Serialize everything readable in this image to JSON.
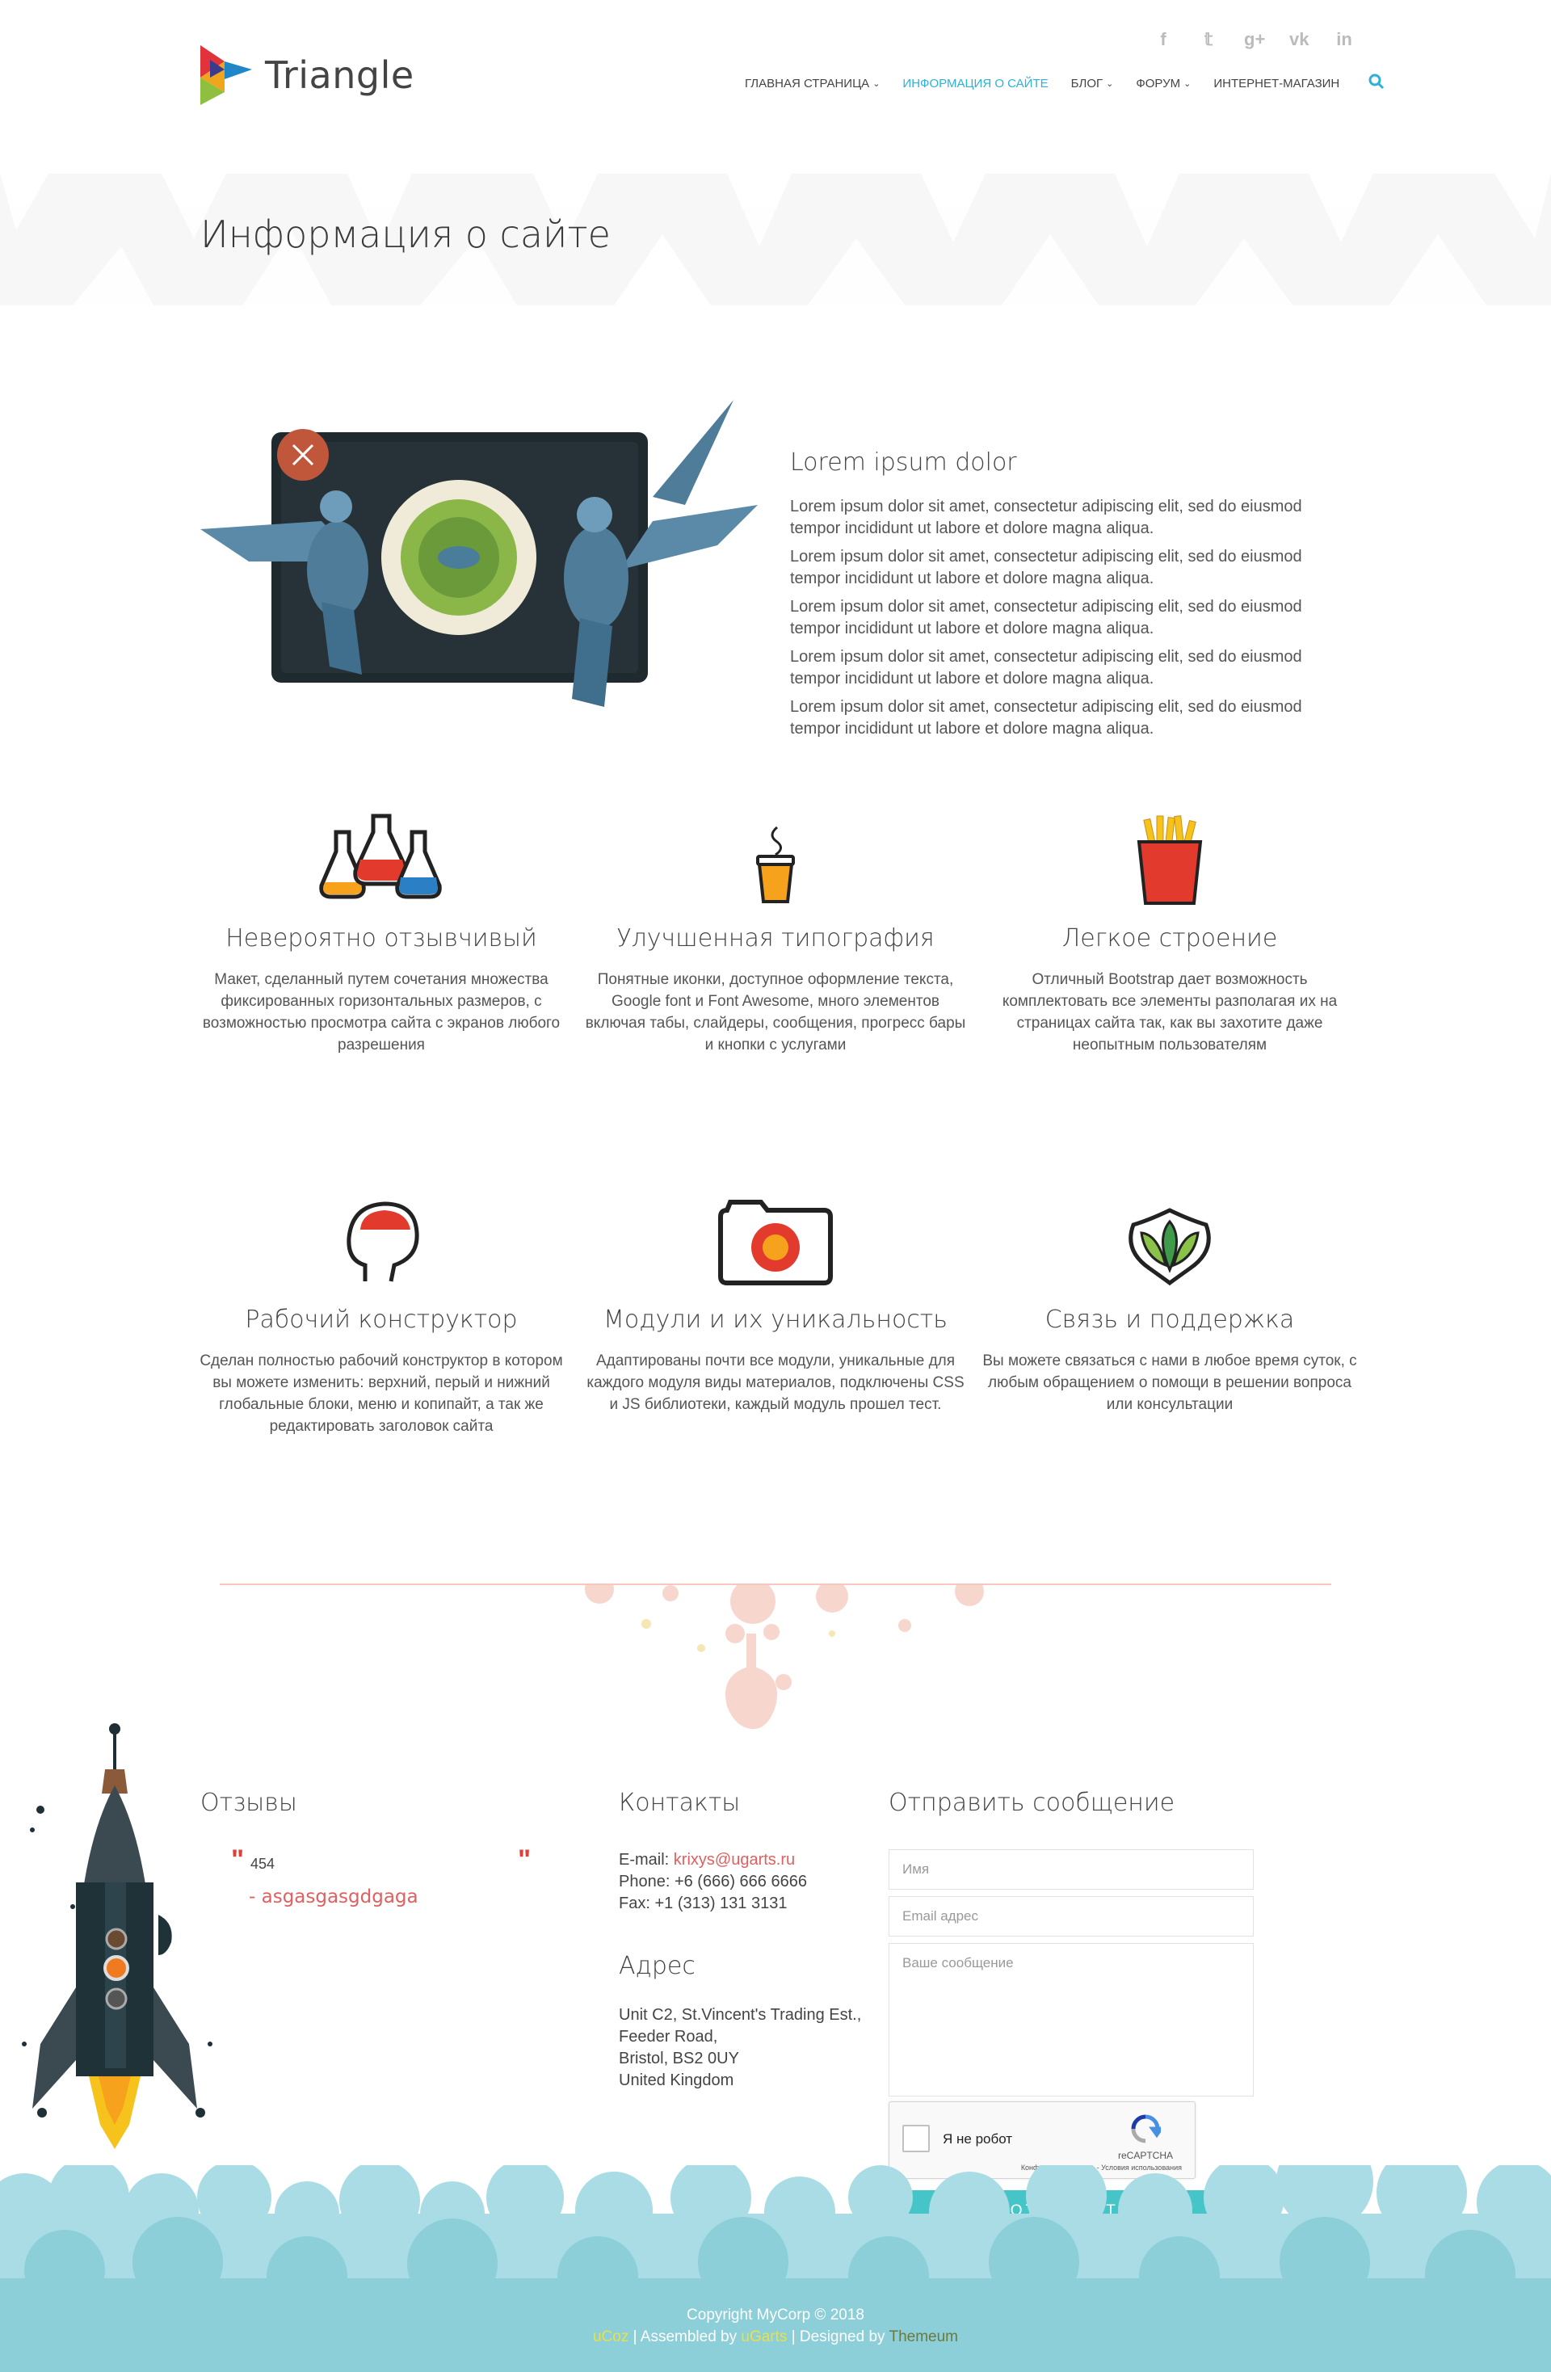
{
  "header": {
    "logo_text": "Triangle",
    "social_icons": [
      "facebook-icon",
      "twitter-icon",
      "google-plus-icon",
      "vk-icon",
      "linkedin-icon"
    ],
    "social_glyphs": [
      "f",
      "𝕥",
      "g+",
      "vk",
      "in"
    ],
    "nav": [
      {
        "label": "ГЛАВНАЯ СТРАНИЦА",
        "dropdown": true,
        "active": false
      },
      {
        "label": "ИНФОРМАЦИЯ О САЙТЕ",
        "dropdown": false,
        "active": true
      },
      {
        "label": "БЛОГ",
        "dropdown": true,
        "active": false
      },
      {
        "label": "ФОРУМ",
        "dropdown": true,
        "active": false
      },
      {
        "label": "ИНТЕРНЕТ-МАГАЗИН",
        "dropdown": false,
        "active": false
      }
    ],
    "accent_color": "#2fb0d8"
  },
  "title_band": {
    "title": "Информация о сайте"
  },
  "intro": {
    "heading": "Lorem ipsum dolor",
    "paragraphs": [
      "Lorem ipsum dolor sit amet, consectetur adipiscing elit, sed do eiusmod tempor incididunt ut labore et dolore magna aliqua.",
      "Lorem ipsum dolor sit amet, consectetur adipiscing elit, sed do eiusmod tempor incididunt ut labore et dolore magna aliqua.",
      "Lorem ipsum dolor sit amet, consectetur adipiscing elit, sed do eiusmod tempor incididunt ut labore et dolore magna aliqua.",
      "Lorem ipsum dolor sit amet, consectetur adipiscing elit, sed do eiusmod tempor incididunt ut labore et dolore magna aliqua.",
      "Lorem ipsum dolor sit amet, consectetur adipiscing elit, sed do eiusmod tempor incididunt ut labore et dolore magna aliqua."
    ]
  },
  "features_row1": [
    {
      "icon": "flasks-icon",
      "title": "Невероятно отзывчивый",
      "text": "Макет, сделанный путем сочетания множества фиксированных горизонтальных размеров, с возможностью просмотра сайта с экранов любого разрешения"
    },
    {
      "icon": "coffee-cup-icon",
      "title": "Улучшенная типография",
      "text": "Понятные иконки, доступное оформление текста, Google font и Font Awesome, много элементов включая табы, слайдеры, сообщения, прогресс бары и кнопки с услугами"
    },
    {
      "icon": "fries-icon",
      "title": "Легкое строение",
      "text": "Отличный Bootstrap дает возможность комплектовать все элементы разполагая их на страницах сайта так, как вы захотите даже неопытным пользователям"
    }
  ],
  "features_row2": [
    {
      "icon": "head-brain-icon",
      "title": "Рабочий конструктор",
      "text": "Сделан полностью рабочий конструктор в котором вы можете изменить: верхний, перый и нижний глобальные блоки, меню и копипайт, а так же редактировать заголовок сайта"
    },
    {
      "icon": "camera-icon",
      "title": "Модули и их уникальность",
      "text": "Адаптированы почти все модули, уникальные для каждого модуля виды материалов, подключены CSS и JS библиотеки, каждый модуль прошел тест."
    },
    {
      "icon": "leaf-shield-icon",
      "title": "Связь и поддержка",
      "text": "Вы можете связаться с нами в любое время суток, с любым обращением о помощи в решении вопроса или консультации"
    }
  ],
  "reviews": {
    "title": "Отзывы",
    "quote_text": "454",
    "quote_author": "- asgasgasgdgaga"
  },
  "contacts": {
    "title": "Контакты",
    "email_label": "E-mail: ",
    "email": "krixys@ugarts.ru",
    "phone": "Phone: +6 (666) 666 6666",
    "fax": "Fax: +1 (313) 131 3131",
    "address_title": "Адрес",
    "address_lines": [
      "Unit C2, St.Vincent's Trading Est.,",
      "Feeder Road,",
      "Bristol, BS2 0UY",
      "United Kingdom"
    ]
  },
  "form": {
    "title": "Отправить сообщение",
    "name_placeholder": "Имя",
    "email_placeholder": "Email адрес",
    "message_placeholder": "Ваше сообщение",
    "captcha_label": "Я не робот",
    "captcha_brand": "reCAPTCHA",
    "captcha_terms": "Конфиденциальность - Условия использования",
    "submit_label": "ОТПРАВИТЬ",
    "submit_color": "#46c5c9"
  },
  "footer": {
    "copyright": "Copyright MyCorp © 2018",
    "ucoz": "uCoz",
    "sep1": " | Assembled by ",
    "ugarts": "uGarts",
    "sep2": " | Designed by ",
    "themeum": "Themeum"
  }
}
